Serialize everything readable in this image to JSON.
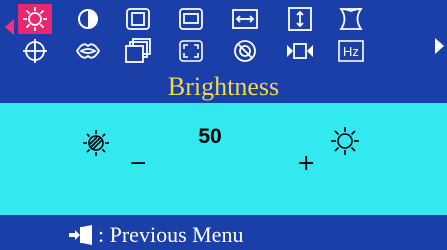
{
  "colors": {
    "background": "#1a3fa8",
    "panel": "#33e9ef",
    "selected": "#e8286e",
    "title": "#f2d84a",
    "icon": "#ffffff"
  },
  "menu": {
    "items": [
      {
        "name": "brightness-icon",
        "selected": true
      },
      {
        "name": "contrast-icon",
        "selected": false
      },
      {
        "name": "h-position-icon",
        "selected": false
      },
      {
        "name": "v-position-icon",
        "selected": false
      },
      {
        "name": "h-size-icon",
        "selected": false
      },
      {
        "name": "v-size-icon",
        "selected": false
      },
      {
        "name": "pincushion-icon",
        "selected": false
      },
      {
        "name": "rotation-icon",
        "selected": false
      },
      {
        "name": "trapezoid-icon",
        "selected": false
      },
      {
        "name": "parallelogram-icon",
        "selected": false
      },
      {
        "name": "zoom-icon",
        "selected": false
      },
      {
        "name": "degauss-icon",
        "selected": false
      },
      {
        "name": "linearity-icon",
        "selected": false
      },
      {
        "name": "frequency-icon",
        "selected": false
      }
    ],
    "hz_label": "Hz"
  },
  "title": "Brightness",
  "adjust": {
    "value": "50",
    "minus": "−",
    "plus": "+"
  },
  "footer": {
    "separator": ":",
    "text": "Previous Menu"
  }
}
